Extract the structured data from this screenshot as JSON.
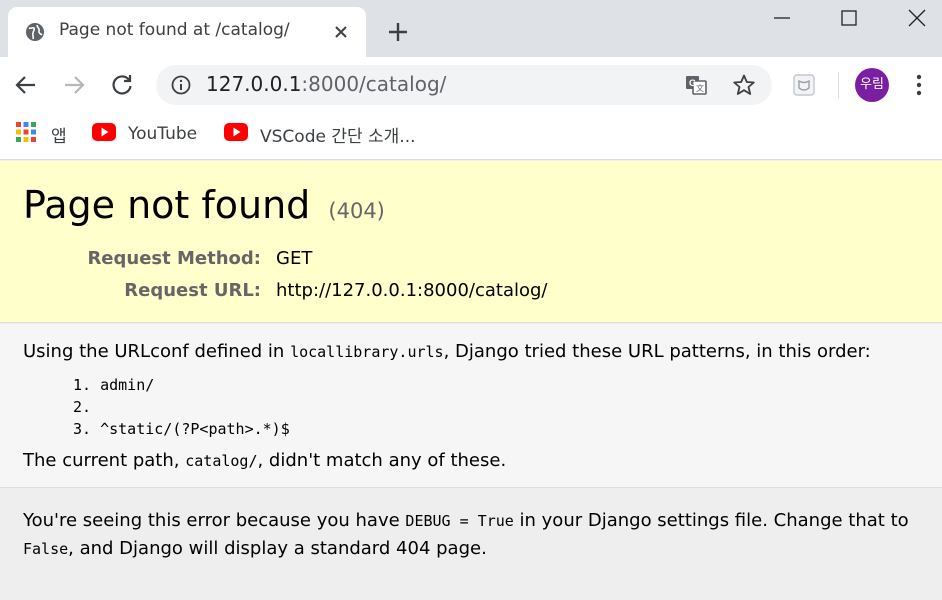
{
  "browser": {
    "tab": {
      "title": "Page not found at /catalog/",
      "favicon": "globe-icon"
    },
    "window_controls": [
      "minimize-icon",
      "maximize-icon",
      "close-icon"
    ],
    "omnibox": {
      "url_host": "127.0.0.1",
      "url_rest": ":8000/catalog/"
    },
    "profile": {
      "initials": "우림",
      "color": "#7b1fa2"
    },
    "bookmarks": [
      {
        "label": "앱",
        "icon": "apps-grid-icon"
      },
      {
        "label": "YouTube",
        "icon": "youtube-icon"
      },
      {
        "label": "VSCode 간단 소개...",
        "icon": "youtube-icon"
      }
    ]
  },
  "page": {
    "heading": "Page not found",
    "status_code": "(404)",
    "request": {
      "method_label": "Request Method:",
      "method_value": "GET",
      "url_label": "Request URL:",
      "url_value": "http://127.0.0.1:8000/catalog/"
    },
    "info": {
      "intro_before": "Using the URLconf defined in ",
      "intro_module": "locallibrary.urls",
      "intro_after": ", Django tried these URL patterns, in this order:",
      "patterns": [
        "1. admin/",
        "2.",
        "3. ^static/(?P<path>.*)$"
      ],
      "path_before": "The current path, ",
      "path_value": "catalog/",
      "path_after": ", didn't match any of these."
    },
    "explanation": {
      "part1": "You're seeing this error because you have ",
      "code1": "DEBUG = True",
      "part2": " in your Django settings file. Change that to ",
      "code2": "False",
      "part3": ", and Django will display a standard 404 page."
    }
  },
  "colors": {
    "summary_bg": "#ffffcc",
    "info_bg": "#f6f6f6",
    "tabstrip_bg": "#dee1e6"
  }
}
